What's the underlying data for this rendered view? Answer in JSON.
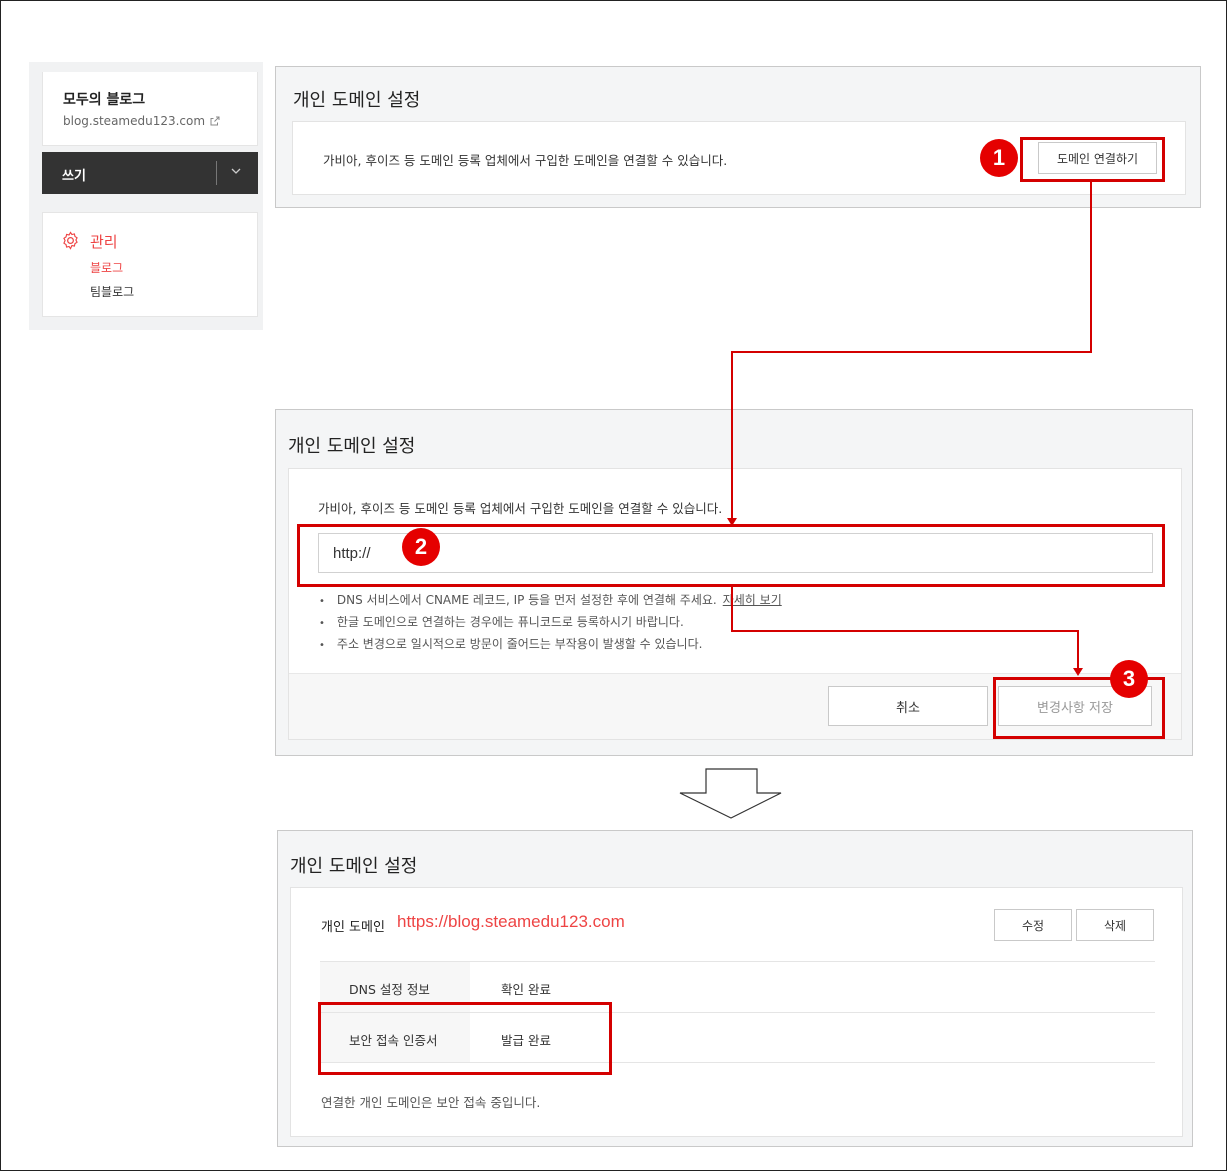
{
  "sidebar": {
    "blog_name": "모두의 블로그",
    "blog_url": "blog.steamedu123.com",
    "write_label": "쓰기",
    "manage_label": "관리",
    "sub_items": [
      "블로그",
      "팀블로그"
    ]
  },
  "step1": {
    "title": "개인 도메인 설정",
    "description": "가비아, 후이즈 등 도메인 등록 업체에서 구입한 도메인을 연결할 수 있습니다.",
    "connect_button": "도메인 연결하기",
    "badge": "1"
  },
  "step2": {
    "title": "개인 도메인 설정",
    "description": "가비아, 후이즈 등 도메인 등록 업체에서 구입한 도메인을 연결할 수 있습니다.",
    "input_value": "http://",
    "badge": "2",
    "notes": [
      "DNS 서비스에서 CNAME 레코드, IP 등을 먼저 설정한 후에 연결해 주세요.",
      "한글 도메인으로 연결하는 경우에는 퓨니코드로 등록하시기 바랍니다.",
      "주소 변경으로 일시적으로 방문이 줄어드는 부작용이 발생할 수 있습니다."
    ],
    "details_link": "자세히 보기",
    "cancel_button": "취소",
    "save_button": "변경사항 저장",
    "badge3": "3"
  },
  "step3": {
    "title": "개인 도메인 설정",
    "domain_label": "개인 도메인",
    "domain_value": "https://blog.steamedu123.com",
    "edit_button": "수정",
    "delete_button": "삭제",
    "rows": [
      {
        "key": "DNS 설정 정보",
        "value": "확인 완료"
      },
      {
        "key": "보안 접속 인증서",
        "value": "발급 완료"
      }
    ],
    "footer_text": "연결한 개인 도메인은 보안 접속 중입니다."
  },
  "colors": {
    "accent": "#e44444",
    "annotation": "#d40000",
    "sidebar_dark": "#333333"
  }
}
